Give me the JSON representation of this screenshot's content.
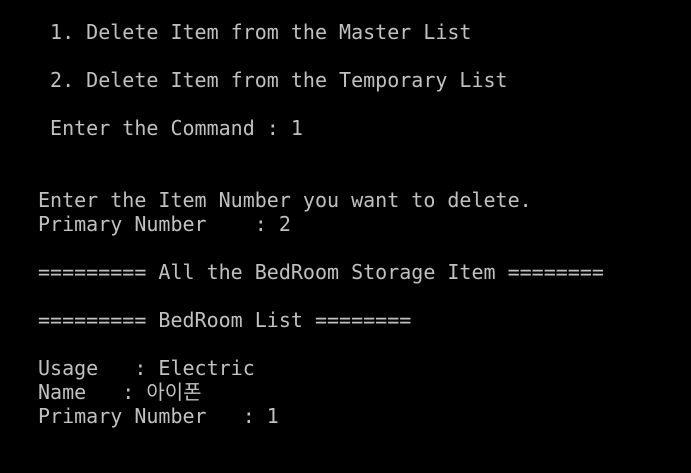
{
  "console": {
    "menu_1": " 1. Delete Item from the Master List",
    "menu_2": " 2. Delete Item from the Temporary List",
    "command_prompt": " Enter the Command : 1",
    "item_prompt": "Enter the Item Number you want to delete.",
    "primary_input": "Primary Number    : 2",
    "storage_header": "========= All the BedRoom Storage Item ========",
    "list_header": "========= BedRoom List ========",
    "usage_line": "Usage   : Electric",
    "name_line": "Name   : 아이폰",
    "primary_line": "Primary Number   : 1"
  },
  "colors": {
    "background": "#000000",
    "text": "#c0c0c0"
  }
}
